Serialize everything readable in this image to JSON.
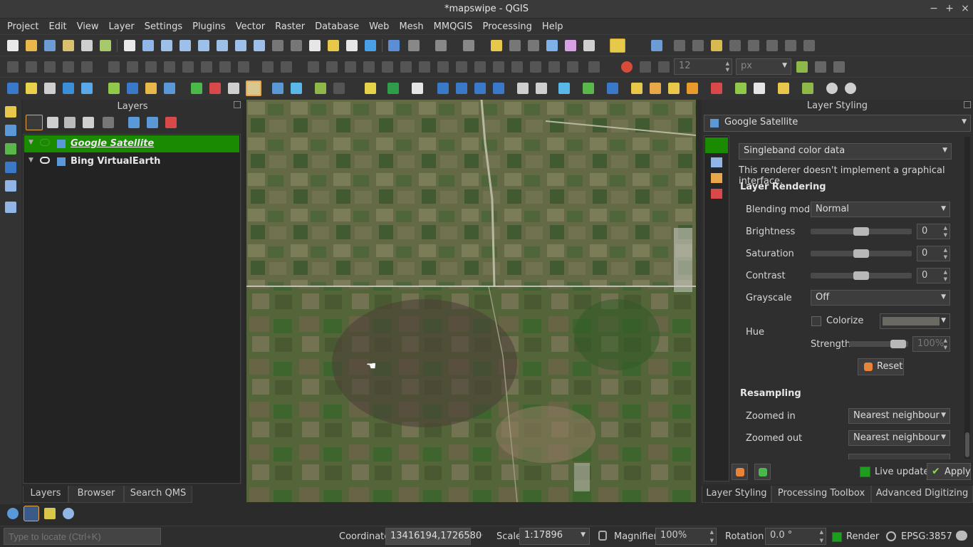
{
  "window": {
    "title": "*mapswipe - QGIS",
    "minimize": "−",
    "maximize": "+",
    "close": "×"
  },
  "menu": [
    "Project",
    "Edit",
    "View",
    "Layer",
    "Settings",
    "Plugins",
    "Vector",
    "Raster",
    "Database",
    "Web",
    "Mesh",
    "MMQGIS",
    "Processing",
    "Help"
  ],
  "toolbar": {
    "font_size_value": "12",
    "font_unit": "px"
  },
  "layers_panel": {
    "title": "Layers",
    "layers": [
      {
        "name": "Google Satellite",
        "selected": true,
        "visible": false
      },
      {
        "name": "Bing VirtualEarth",
        "selected": false,
        "visible": true
      }
    ],
    "tabs": [
      "Layers",
      "Browser",
      "Search QMS"
    ]
  },
  "styling_panel": {
    "title": "Layer Styling",
    "layer_combo": "Google Satellite",
    "renderer": "Singleband color data",
    "renderer_note": "This renderer doesn't implement a graphical interface.",
    "section_rendering": "Layer Rendering",
    "blending_label": "Blending mode",
    "blending_value": "Normal",
    "brightness_label": "Brightness",
    "brightness_value": "0",
    "saturation_label": "Saturation",
    "saturation_value": "0",
    "contrast_label": "Contrast",
    "contrast_value": "0",
    "grayscale_label": "Grayscale",
    "grayscale_value": "Off",
    "hue_label": "Hue",
    "colorize_label": "Colorize",
    "strength_label": "Strength",
    "strength_value": "100%",
    "reset_label": "Reset",
    "section_resampling": "Resampling",
    "zoomed_in_label": "Zoomed in",
    "zoomed_in_value": "Nearest neighbour",
    "zoomed_out_label": "Zoomed out",
    "zoomed_out_value": "Nearest neighbour",
    "live_update_label": "Live update",
    "apply_label": "Apply",
    "tabs": [
      "Layer Styling",
      "Processing Toolbox",
      "Advanced Digitizing"
    ]
  },
  "statusbar": {
    "locate_placeholder": "Type to locate (Ctrl+K)",
    "coordinate_label": "Coordinate",
    "coordinate_value": "13416194,1726580",
    "scale_label": "Scale",
    "scale_value": "1:17896",
    "magnifier_label": "Magnifier",
    "magnifier_value": "100%",
    "rotation_label": "Rotation",
    "rotation_value": "0.0 °",
    "render_label": "Render",
    "crs_value": "EPSG:3857"
  },
  "colors": {
    "selected_layer_bg": "#1a8a00",
    "accent_green": "#1f9d1f",
    "panel_bg": "#2f2f2f"
  }
}
